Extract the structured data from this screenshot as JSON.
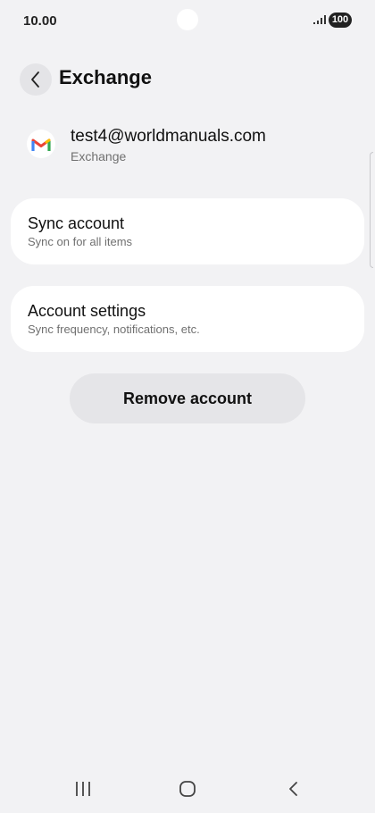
{
  "status_bar": {
    "time": "10.00",
    "battery": "100",
    "icons": [
      "camera-cutout",
      "signal-icon",
      "battery-icon"
    ]
  },
  "header": {
    "title": "Exchange",
    "back_icon": "chevron-left-icon"
  },
  "account": {
    "email": "test4@worldmanuals.com",
    "type": "Exchange",
    "icon": "gmail-icon"
  },
  "cards": {
    "sync": {
      "title": "Sync account",
      "subtitle": "Sync on for all items"
    },
    "settings": {
      "title": "Account settings",
      "subtitle": "Sync frequency, notifications, etc."
    }
  },
  "remove_button": {
    "label": "Remove account"
  },
  "nav_bar": {
    "icons": [
      "recents-icon",
      "home-icon",
      "back-icon"
    ]
  },
  "colors": {
    "background": "#f2f2f4",
    "card": "#ffffff",
    "button": "#e5e5e8",
    "gmail_red": "#EA4335",
    "gmail_blue": "#4285F4",
    "gmail_green": "#34A853",
    "gmail_yellow": "#FBBC04"
  }
}
